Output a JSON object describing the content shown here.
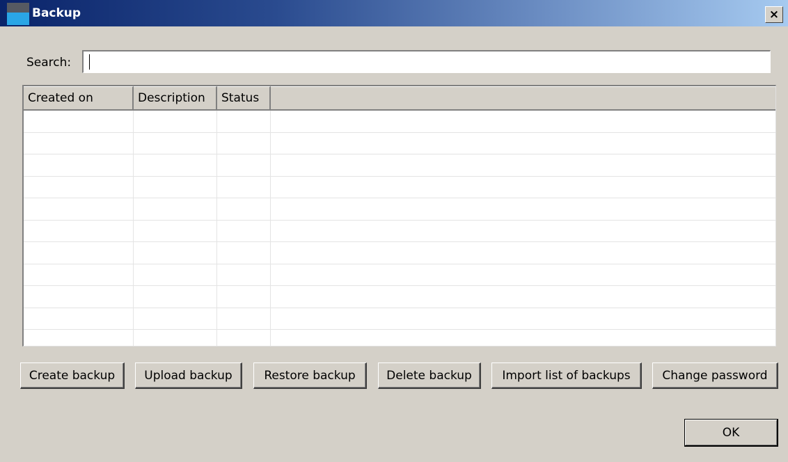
{
  "window": {
    "title": "Backup",
    "close_label": "×"
  },
  "search": {
    "label": "Search:",
    "value": "",
    "placeholder": ""
  },
  "table": {
    "columns": [
      "Created on",
      "Description",
      "Status",
      ""
    ],
    "rows": []
  },
  "actions": {
    "create_backup": "Create backup",
    "upload_backup": "Upload backup",
    "restore_backup": "Restore backup",
    "delete_backup": "Delete backup",
    "import_list": "Import list of backups",
    "change_password": "Change password"
  },
  "dialog": {
    "ok_label": "OK"
  },
  "colors": {
    "face": "#d4d0c8",
    "title_start": "#0a246a",
    "title_end": "#a6caf0"
  },
  "icons": {
    "app": "app-window-icon"
  }
}
